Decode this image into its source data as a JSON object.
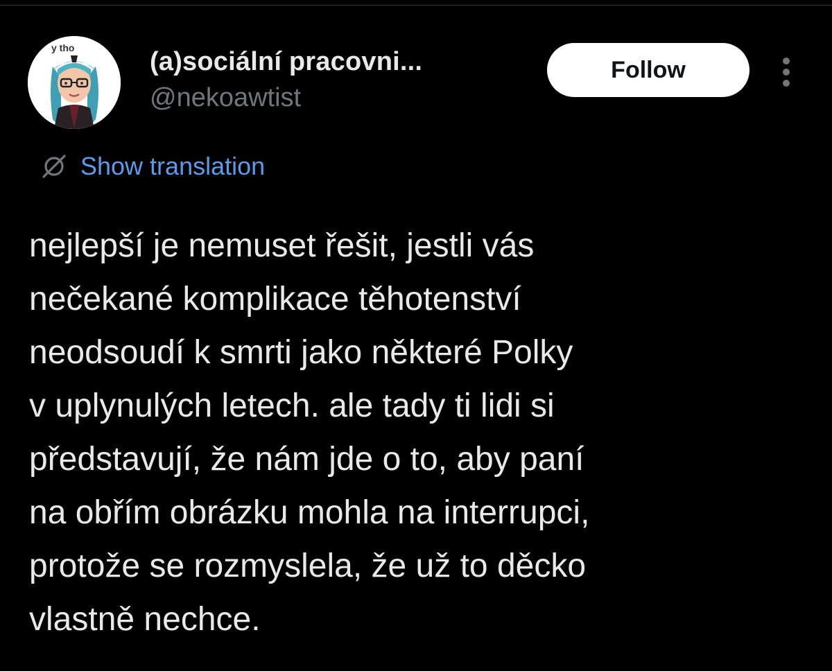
{
  "post": {
    "author": {
      "display_name": "(a)sociální pracovni...",
      "handle": "@nekoawtist",
      "avatar_caption": "y tho"
    },
    "follow_label": "Follow",
    "more_icon": "vertical-ellipsis-icon",
    "translation": {
      "icon": "globe-icon",
      "label": "Show translation"
    },
    "text_lines": [
      "nejlepší je nemuset řešit, jestli vás",
      "nečekané komplikace těhotenství",
      "neodsoudí k smrti jako některé Polky",
      "v uplynulých letech. ale tady ti lidi si",
      "představují, že nám jde o to, aby paní",
      "na obřím obrázku mohla na interrupci,",
      "protože se rozmyslela, že už to děcko",
      "vlastně nechce."
    ]
  },
  "colors": {
    "background": "#000000",
    "primary_text": "#e7e9ea",
    "secondary_text": "#71767b",
    "link": "#5b9bea",
    "follow_button_bg": "#ffffff",
    "follow_button_text": "#0f1419"
  }
}
